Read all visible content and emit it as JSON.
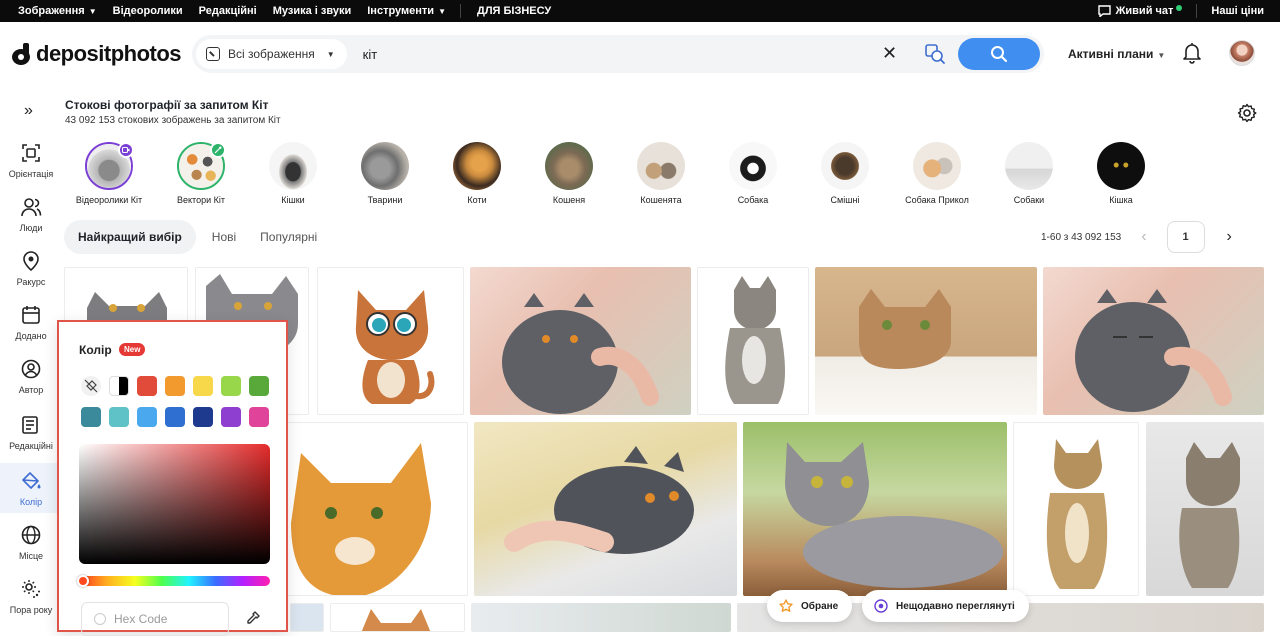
{
  "topnav": {
    "items": [
      {
        "label": "Зображення",
        "caret": true
      },
      {
        "label": "Відеоролики",
        "caret": false
      },
      {
        "label": "Редакційні",
        "caret": false
      },
      {
        "label": "Музика і звуки",
        "caret": false
      },
      {
        "label": "Інструменти",
        "caret": true
      }
    ],
    "business": "ДЛЯ БІЗНЕСУ",
    "chat": "Живий чат",
    "prices": "Наші ціни"
  },
  "header": {
    "logo": "depositphotos",
    "category": "Всі зображення",
    "query": "кіт",
    "plans": "Активні плани"
  },
  "sidebar": {
    "items": [
      {
        "label": "Орієнтація",
        "icon": "orientation-icon"
      },
      {
        "label": "Люди",
        "icon": "people-icon"
      },
      {
        "label": "Ракурс",
        "icon": "angle-icon"
      },
      {
        "label": "Додано",
        "icon": "calendar-icon"
      },
      {
        "label": "Автор",
        "icon": "author-icon"
      },
      {
        "label": "Редакційні",
        "icon": "editorial-icon"
      },
      {
        "label": "Колір",
        "icon": "color-bucket-icon"
      },
      {
        "label": "Місце",
        "icon": "globe-icon"
      },
      {
        "label": "Пора року",
        "icon": "season-icon"
      }
    ],
    "active": "Колір"
  },
  "results": {
    "title": "Стокові фотографії за запитом Кіт",
    "subtitle": "43 092 153 стокових зображень за запитом Кіт"
  },
  "chips": [
    {
      "label": "Відеоролики Кіт",
      "badge": "video",
      "badge_color": "#7b3fd6"
    },
    {
      "label": "Вектори Кіт",
      "badge": "vector",
      "badge_color": "#2db36a"
    },
    {
      "label": "Кішки"
    },
    {
      "label": "Тварини"
    },
    {
      "label": "Коти"
    },
    {
      "label": "Кошеня"
    },
    {
      "label": "Кошенята"
    },
    {
      "label": "Собака"
    },
    {
      "label": "Смішні"
    },
    {
      "label": "Собака Прикол"
    },
    {
      "label": "Собаки"
    },
    {
      "label": "Кішка"
    }
  ],
  "tabs": {
    "items": [
      "Найкращий вибір",
      "Нові",
      "Популярні"
    ],
    "active": "Найкращий вибір"
  },
  "pagination": {
    "range": "1-60 з 43 092 153",
    "page": "1"
  },
  "color_filter": {
    "title": "Колір",
    "badge": "New",
    "swatches_row1": [
      "none",
      "#000000",
      "#e04b3a",
      "#f29a2e",
      "#f7d84a",
      "#98d64a",
      "#58a83a"
    ],
    "swatches_row2": [
      "#3a8a9c",
      "#5ec2c6",
      "#4aa8ee",
      "#2f6fd2",
      "#1e3a8f",
      "#8e3fd0",
      "#e0439a"
    ],
    "hex_placeholder": "Hex Code"
  },
  "floating": {
    "favorites": "Обране",
    "recent": "Нещодавно переглянуті"
  },
  "colors": {
    "accent": "#3f8ef0",
    "highlight": "#e0544a"
  }
}
